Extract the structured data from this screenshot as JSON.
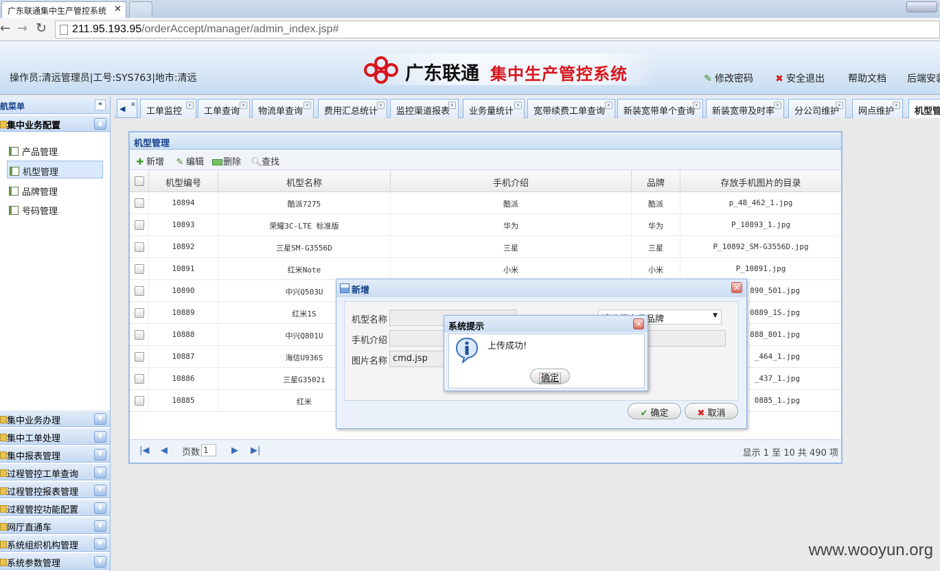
{
  "browser": {
    "tabs": [
      {
        "title": "广东联通集中生产管控系统"
      }
    ],
    "url_host": "211.95.193.95",
    "url_path": "/orderAccept/manager/admin_index.jsp#"
  },
  "header": {
    "operator": "操作员:清远管理员|工号:SYS763|地市:清远",
    "logo_text": "广东联通",
    "system_title": "集中生产管控系统",
    "links": {
      "change_password": "修改密码",
      "logout": "安全退出",
      "help": "帮助文档",
      "backend": "后端安装"
    }
  },
  "sidebar": {
    "title": "导航菜单",
    "open_panel": "集中业务配置",
    "items": [
      {
        "label": "产品管理"
      },
      {
        "label": "机型管理"
      },
      {
        "label": "品牌管理"
      },
      {
        "label": "号码管理"
      }
    ],
    "panels": [
      "集中业务办理",
      "集中工单处理",
      "集中报表管理",
      "过程管控工单查询",
      "过程管控报表管理",
      "过程管控功能配置",
      "网厅直通车",
      "系统组织机构管理",
      "系统参数管理"
    ]
  },
  "tabs": [
    "工单监控",
    "工单查询",
    "物流单查询",
    "费用汇总统计",
    "监控渠道报表",
    "业务量统计",
    "宽带续费工单查询",
    "新装宽带单个查询",
    "新装宽带及时率",
    "分公司维护",
    "网点维护",
    "机型管理"
  ],
  "grid": {
    "title": "机型管理",
    "toolbar": {
      "add": "新增",
      "edit": "编辑",
      "delete": "删除",
      "search": "查找"
    },
    "columns": [
      "机型编号",
      "机型名称",
      "手机介绍",
      "品牌",
      "存放手机图片的目录"
    ],
    "rows": [
      {
        "id": "10894",
        "name": "酷派7275",
        "intro": "酷派",
        "brand": "酷派",
        "dir": "p_48_462_1.jpg"
      },
      {
        "id": "10893",
        "name": "荣耀3C-LTE 标准版",
        "intro": "华为",
        "brand": "华为",
        "dir": "P_10893_1.jpg"
      },
      {
        "id": "10892",
        "name": "三星SM-G3556D",
        "intro": "三星",
        "brand": "三星",
        "dir": "P_10892_SM-G3556D.jpg"
      },
      {
        "id": "10891",
        "name": "红米Note",
        "intro": "小米",
        "brand": "小米",
        "dir": "P_10891.jpg"
      },
      {
        "id": "10890",
        "name": "中兴Q503U",
        "intro": "",
        "brand": "",
        "dir": "890_501.jpg"
      },
      {
        "id": "10889",
        "name": "红米1S",
        "intro": "",
        "brand": "",
        "dir": "0889_1S.jpg"
      },
      {
        "id": "10888",
        "name": "中兴Q801U",
        "intro": "",
        "brand": "",
        "dir": "888_801.jpg"
      },
      {
        "id": "10887",
        "name": "海信U936S",
        "intro": "",
        "brand": "",
        "dir": "_464_1.jpg"
      },
      {
        "id": "10886",
        "name": "三星G3502i",
        "intro": "",
        "brand": "",
        "dir": "_437_1.jpg"
      },
      {
        "id": "10885",
        "name": "红米",
        "intro": "",
        "brand": "",
        "dir": "0885_1.jpg"
      }
    ],
    "pager": {
      "page_label": "页数",
      "page": "1",
      "summary": "显示 1 至 10 共 490 项"
    }
  },
  "add_dialog": {
    "title": "新增",
    "fields": {
      "model_name": "机型名称",
      "brand": "品牌",
      "brand_placeholder": "请选择产品品牌",
      "intro": "手机介绍",
      "image": "图片名称",
      "image_value": "cmd.jsp"
    },
    "ok": "确定",
    "cancel": "取消"
  },
  "alert": {
    "title": "系统提示",
    "message": "上传成功!",
    "ok": "确定"
  },
  "watermark": "www.wooyun.org"
}
